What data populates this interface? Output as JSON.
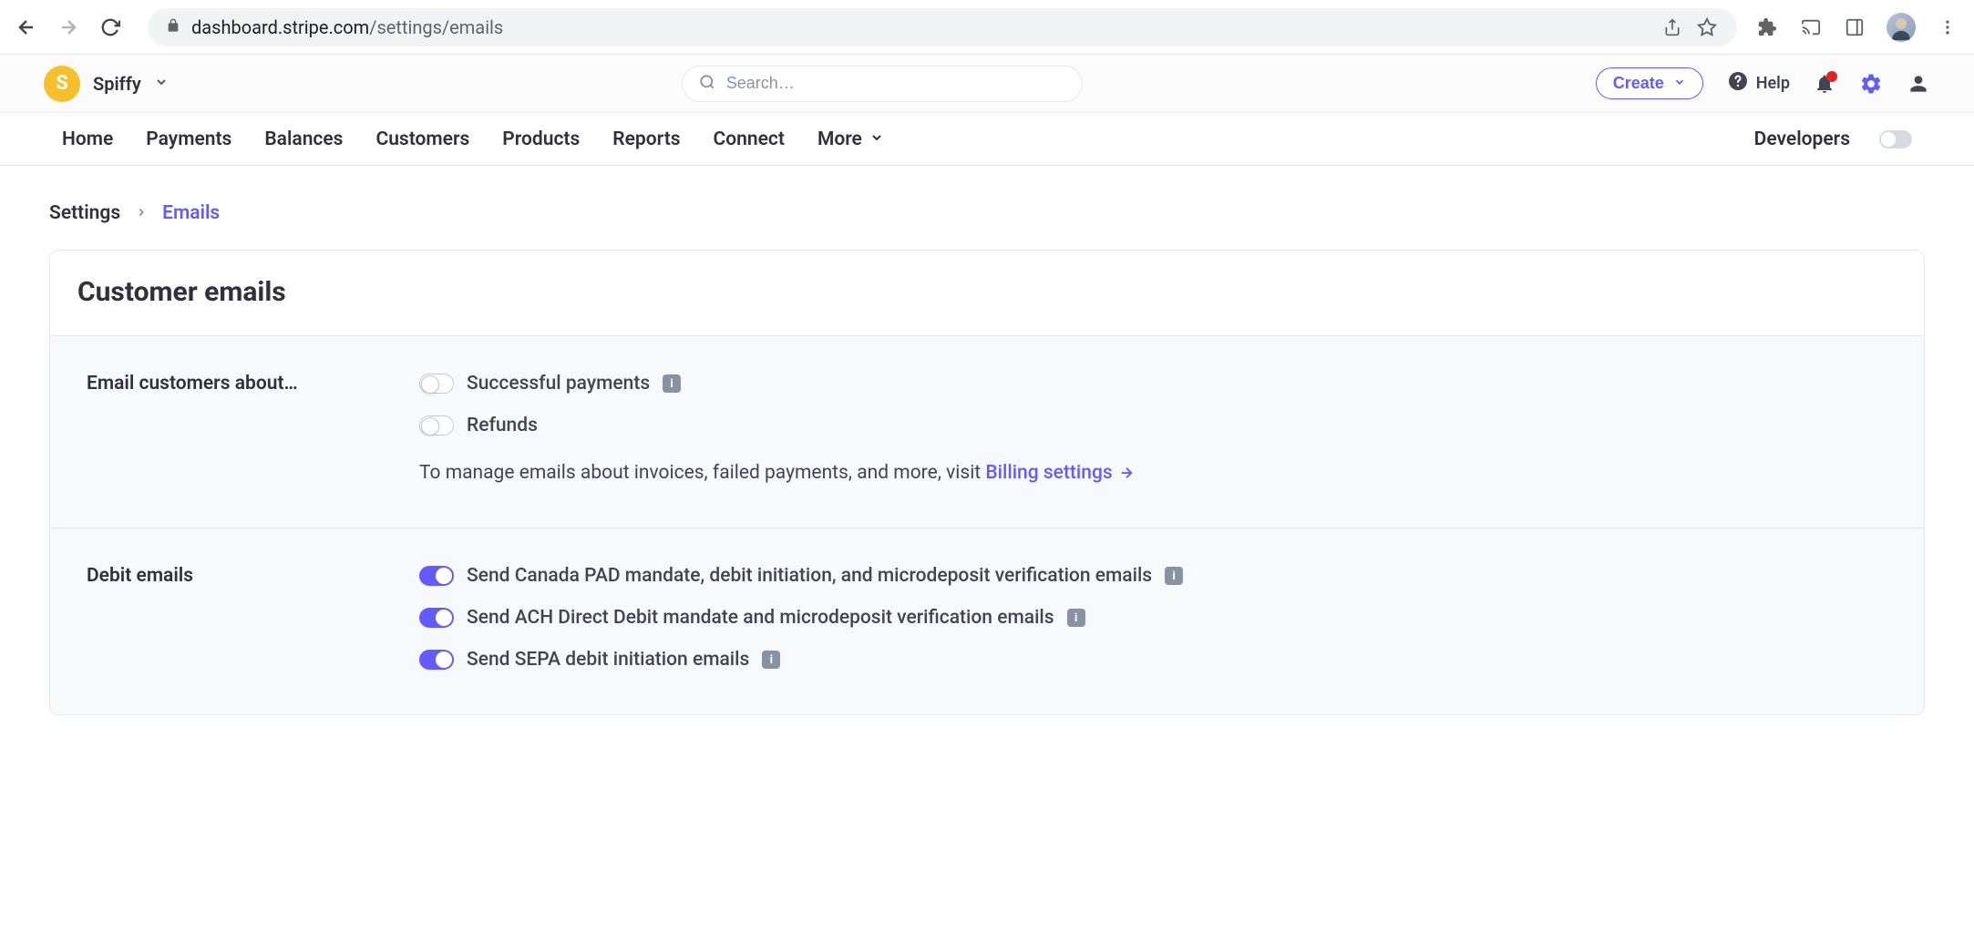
{
  "browser": {
    "url_domain": "dashboard.stripe.com",
    "url_path": "/settings/emails"
  },
  "header": {
    "org_letter": "S",
    "org_name": "Spiffy",
    "search_placeholder": "Search…",
    "create_label": "Create",
    "help_label": "Help"
  },
  "nav": {
    "items": [
      "Home",
      "Payments",
      "Balances",
      "Customers",
      "Products",
      "Reports",
      "Connect",
      "More"
    ],
    "developers_label": "Developers"
  },
  "breadcrumb": {
    "parent": "Settings",
    "current": "Emails"
  },
  "panel": {
    "title": "Customer emails"
  },
  "section1": {
    "label": "Email customers about…",
    "toggles": [
      {
        "label": "Successful payments",
        "on": false,
        "info": true
      },
      {
        "label": "Refunds",
        "on": false,
        "info": false
      }
    ],
    "helper_prefix": "To manage emails about invoices, failed payments, and more, visit ",
    "helper_link": "Billing settings"
  },
  "section2": {
    "label": "Debit emails",
    "toggles": [
      {
        "label": "Send Canada PAD mandate, debit initiation, and microdeposit verification emails",
        "on": true,
        "info": true
      },
      {
        "label": "Send ACH Direct Debit mandate and microdeposit verification emails",
        "on": true,
        "info": true
      },
      {
        "label": "Send SEPA debit initiation emails",
        "on": true,
        "info": true
      }
    ]
  }
}
